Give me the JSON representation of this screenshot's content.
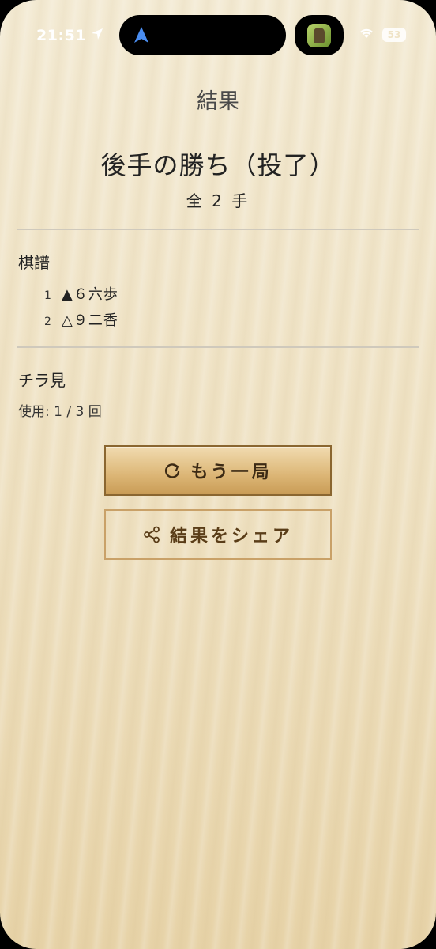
{
  "status_bar": {
    "time": "21:51",
    "battery": "53",
    "icons": [
      "location-arrow-icon",
      "navigation-icon",
      "app-icon",
      "wifi-icon",
      "battery-icon"
    ]
  },
  "page": {
    "title": "結果",
    "result": "後手の勝ち（投了）",
    "move_count": "全 2 手"
  },
  "kifu": {
    "heading": "棋譜",
    "moves": [
      {
        "num": "1",
        "text": "▲６六歩"
      },
      {
        "num": "2",
        "text": "△９二香"
      }
    ]
  },
  "peek": {
    "heading": "チラ見",
    "usage": "使用: 1 / 3 回"
  },
  "buttons": {
    "play_again": "もう一局",
    "share": "結果をシェア",
    "play_again_icon": "refresh-icon",
    "share_icon": "share-icon"
  },
  "colors": {
    "background": "#efe3c6",
    "button_fill": "#dcb676",
    "button_border": "#8a6630",
    "divider": "#cfc9bc"
  }
}
